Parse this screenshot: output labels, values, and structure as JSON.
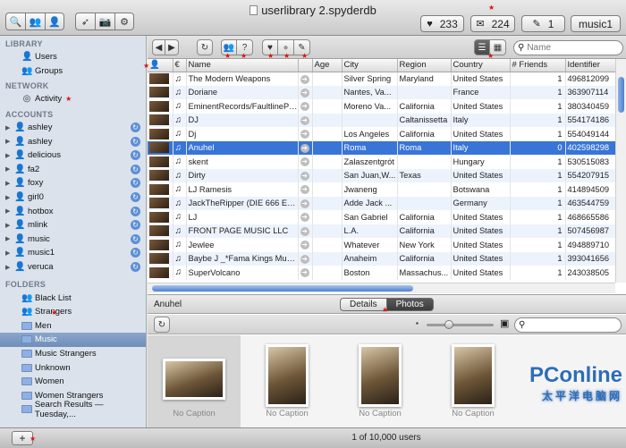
{
  "window": {
    "title": "userlibrary 2.spyderdb"
  },
  "toolbar": {
    "stats": [
      {
        "icon": "heart-icon",
        "glyph": "♥",
        "value": "233"
      },
      {
        "icon": "speech-bubble-icon",
        "glyph": "💬",
        "value": "224"
      },
      {
        "icon": "compose-icon",
        "glyph": "✎",
        "value": "1"
      }
    ],
    "account": "music1"
  },
  "sidebar": {
    "library_header": "LIBRARY",
    "library": [
      {
        "label": "Users",
        "icon": "users-icon"
      },
      {
        "label": "Groups",
        "icon": "groups-icon"
      }
    ],
    "network_header": "NETWORK",
    "network": [
      {
        "label": "Activity",
        "icon": "activity-icon"
      }
    ],
    "accounts_header": "ACCOUNTS",
    "accounts": [
      {
        "label": "ashley"
      },
      {
        "label": "ashley"
      },
      {
        "label": "delicious"
      },
      {
        "label": "fa2"
      },
      {
        "label": "foxy"
      },
      {
        "label": "girl0"
      },
      {
        "label": "hotbox"
      },
      {
        "label": "mlink"
      },
      {
        "label": "music"
      },
      {
        "label": "music1"
      },
      {
        "label": "veruca"
      }
    ],
    "folders_header": "FOLDERS",
    "folders": [
      {
        "label": "Black List",
        "icon": "users-icon"
      },
      {
        "label": "Strangers",
        "icon": "users-icon"
      },
      {
        "label": "Men",
        "icon": "folder-icon"
      },
      {
        "label": "Music",
        "icon": "folder-icon"
      },
      {
        "label": "Music Strangers",
        "icon": "folder-icon"
      },
      {
        "label": "Unknown",
        "icon": "folder-icon"
      },
      {
        "label": "Women",
        "icon": "folder-icon"
      },
      {
        "label": "Women Strangers",
        "icon": "folder-icon"
      },
      {
        "label": "Search Results — Tuesday,...",
        "icon": "folder-icon"
      }
    ],
    "selected_folder": "Music"
  },
  "table": {
    "search_placeholder": "Name",
    "columns": [
      "",
      "",
      "Name",
      "",
      "Age",
      "City",
      "Region",
      "Country",
      "# Friends",
      "Identifier"
    ],
    "rows": [
      {
        "name": "The Modern Weapons",
        "age": "",
        "city": "Silver Spring",
        "region": "Maryland",
        "country": "United States",
        "friends": "1",
        "id": "496812099"
      },
      {
        "name": "Doriane",
        "age": "",
        "city": "Nantes, Va...",
        "region": "",
        "country": "France",
        "friends": "1",
        "id": "363907114"
      },
      {
        "name": "EminentRecords/FaultlinePr...",
        "age": "",
        "city": "Moreno Va...",
        "region": "California",
        "country": "United States",
        "friends": "1",
        "id": "380340459"
      },
      {
        "name": "DJ",
        "age": "",
        "city": "",
        "region": "Caltanissetta",
        "country": "Italy",
        "friends": "1",
        "id": "554174186"
      },
      {
        "name": "Dj",
        "age": "",
        "city": "Los Angeles",
        "region": "California",
        "country": "United States",
        "friends": "1",
        "id": "554049144"
      },
      {
        "name": "Anuhel",
        "age": "",
        "city": "Roma",
        "region": "Roma",
        "country": "Italy",
        "friends": "0",
        "id": "402598298"
      },
      {
        "name": "skent",
        "age": "",
        "city": "Zalaszentgrót",
        "region": "",
        "country": "Hungary",
        "friends": "1",
        "id": "530515083"
      },
      {
        "name": "Dirty",
        "age": "",
        "city": "San Juan,W...",
        "region": "Texas",
        "country": "United States",
        "friends": "1",
        "id": "554207915"
      },
      {
        "name": "LJ Ramesis",
        "age": "",
        "city": "Jwaneng",
        "region": "",
        "country": "Botswana",
        "friends": "1",
        "id": "414894509"
      },
      {
        "name": "JackTheRipper (DIE 666 EP J...",
        "age": "",
        "city": "Adde Jack ...",
        "region": "",
        "country": "Germany",
        "friends": "1",
        "id": "463544759"
      },
      {
        "name": "LJ",
        "age": "",
        "city": "San Gabriel",
        "region": "California",
        "country": "United States",
        "friends": "1",
        "id": "468665586"
      },
      {
        "name": "FRONT PAGE MUSIC LLC",
        "age": "",
        "city": "L.A.",
        "region": "California",
        "country": "United States",
        "friends": "1",
        "id": "507456987"
      },
      {
        "name": "Jewlee",
        "age": "",
        "city": "Whatever",
        "region": "New York",
        "country": "United States",
        "friends": "1",
        "id": "494889710"
      },
      {
        "name": "Baybe J _*Fama Kings Music*_",
        "age": "",
        "city": "Anaheim",
        "region": "California",
        "country": "United States",
        "friends": "1",
        "id": "393041656"
      },
      {
        "name": "SuperVolcano",
        "age": "",
        "city": "Boston",
        "region": "Massachus...",
        "country": "United States",
        "friends": "1",
        "id": "243038505"
      }
    ],
    "selected_row": 5
  },
  "details": {
    "name": "Anuhel",
    "tabs": [
      "Details",
      "Photos"
    ],
    "active_tab": "Photos",
    "photos": [
      {
        "caption": "No Caption"
      },
      {
        "caption": "No Caption"
      },
      {
        "caption": "No Caption"
      },
      {
        "caption": "No Caption"
      }
    ]
  },
  "status": {
    "count": "1 of 10,000 users"
  },
  "watermark": {
    "brand": "PConline",
    "sub": "太平洋电脑网"
  }
}
